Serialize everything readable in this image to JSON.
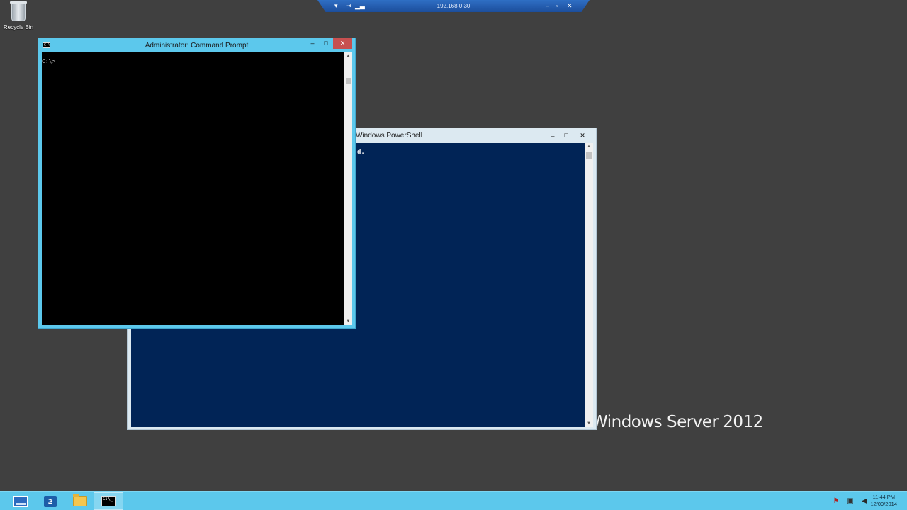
{
  "remote_bar": {
    "host": "192.168.0.30",
    "icons": [
      "chevron-down-icon",
      "pin-icon",
      "signal-icon",
      "minimize-icon",
      "restore-icon",
      "close-icon"
    ]
  },
  "desktop": {
    "icons": [
      {
        "label": "Recycle Bin",
        "icon": "recycle-bin-icon"
      }
    ],
    "watermark": "Windows Server 2012"
  },
  "powershell_window": {
    "title": "Windows PowerShell",
    "output_line": "d.",
    "buttons": {
      "minimize": "–",
      "maximize": "□",
      "close": "✕"
    },
    "colors": {
      "background": "#012456",
      "foreground": "#eeedf0"
    }
  },
  "cmd_window": {
    "title": "Administrator: Command Prompt",
    "prompt": "C:\\>_",
    "buttons": {
      "minimize": "–",
      "maximize": "□",
      "close": "✕"
    },
    "colors": {
      "background": "#000000",
      "foreground": "#c0c0c0",
      "frame": "#5cc8ec"
    }
  },
  "taskbar": {
    "apps": [
      {
        "name": "Server Manager",
        "icon": "server-manager-icon"
      },
      {
        "name": "Windows PowerShell",
        "icon": "powershell-icon"
      },
      {
        "name": "File Explorer",
        "icon": "folder-icon"
      },
      {
        "name": "Command Prompt",
        "icon": "cmd-icon",
        "active": true
      }
    ],
    "tray_icons": [
      "action-center-flag-icon",
      "network-icon",
      "volume-icon"
    ],
    "clock": {
      "time": "11:44 PM",
      "date": "12/09/2014"
    }
  }
}
